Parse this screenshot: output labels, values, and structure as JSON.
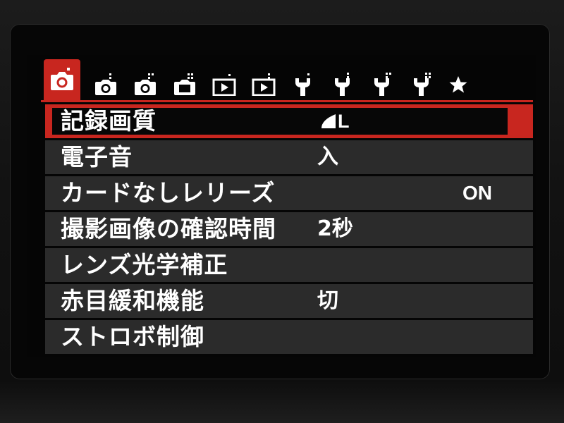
{
  "tabs": [
    {
      "name": "shooting-1",
      "icon": "camera-icon",
      "dots": 1,
      "active": true
    },
    {
      "name": "shooting-2",
      "icon": "camera-icon",
      "dots": 2
    },
    {
      "name": "shooting-3",
      "icon": "camera-icon",
      "dots": 3
    },
    {
      "name": "shooting-4",
      "icon": "camera-icon",
      "dots": 4
    },
    {
      "name": "playback-1",
      "icon": "playback-icon",
      "dots": 1
    },
    {
      "name": "playback-2",
      "icon": "playback-icon",
      "dots": 2
    },
    {
      "name": "setup-1",
      "icon": "wrench-icon",
      "dots": 1
    },
    {
      "name": "setup-2",
      "icon": "wrench-icon",
      "dots": 2
    },
    {
      "name": "setup-3",
      "icon": "wrench-icon",
      "dots": 3
    },
    {
      "name": "setup-4",
      "icon": "wrench-icon",
      "dots": 4
    },
    {
      "name": "my-menu",
      "icon": "star-icon"
    }
  ],
  "menu": {
    "items": [
      {
        "label": "記録画質",
        "value": "L",
        "value_icon": "quality-fine-icon",
        "selected": true
      },
      {
        "label": "電子音",
        "value": "入"
      },
      {
        "label": "カードなしレリーズ",
        "value": "ON"
      },
      {
        "label": "撮影画像の確認時間",
        "value": "2秒"
      },
      {
        "label": "レンズ光学補正",
        "value": ""
      },
      {
        "label": "赤目緩和機能",
        "value": "切"
      },
      {
        "label": "ストロボ制御",
        "value": ""
      }
    ]
  },
  "colors": {
    "accent": "#c8261f",
    "row_background": "#2b2b2b",
    "screen_background": "#050505",
    "text": "#ffffff"
  }
}
